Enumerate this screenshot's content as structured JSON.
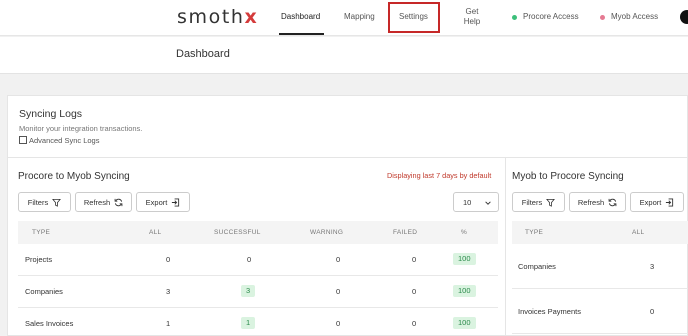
{
  "brand": {
    "logo_main": "smoth",
    "logo_x": "x"
  },
  "nav": {
    "dashboard": "Dashboard",
    "mapping": "Mapping",
    "settings": "Settings",
    "get_help": "Get Help",
    "procore_access": "Procore Access",
    "myob_access": "Myob Access"
  },
  "colors": {
    "procore_dot": "#3bbf7a",
    "myob_dot": "#e57a92",
    "highlight": "#c62828"
  },
  "page": {
    "title": "Dashboard"
  },
  "syncing": {
    "title": "Syncing Logs",
    "subtitle": "Monitor your integration transactions.",
    "advanced_label": "Advanced Sync Logs"
  },
  "left": {
    "title": "Procore to Myob Syncing",
    "notice": "Displaying last 7 days by default",
    "filters": "Filters",
    "refresh": "Refresh",
    "export": "Export",
    "page_size": "10",
    "columns": [
      "TYPE",
      "ALL",
      "SUCCESSFUL",
      "WARNING",
      "FAILED",
      "%"
    ],
    "rows": [
      {
        "type": "Projects",
        "all": "0",
        "successful": "0",
        "warning": "0",
        "failed": "0",
        "pct": "100"
      },
      {
        "type": "Companies",
        "all": "3",
        "successful": "3",
        "warning": "0",
        "failed": "0",
        "pct": "100"
      },
      {
        "type": "Sales Invoices",
        "all": "1",
        "successful": "1",
        "warning": "0",
        "failed": "0",
        "pct": "100"
      }
    ]
  },
  "right": {
    "title": "Myob to Procore Syncing",
    "filters": "Filters",
    "refresh": "Refresh",
    "export": "Export",
    "columns": [
      "TYPE",
      "ALL"
    ],
    "rows": [
      {
        "type": "Companies",
        "all": "3"
      },
      {
        "type": "Invoices Payments",
        "all": "0"
      }
    ]
  }
}
